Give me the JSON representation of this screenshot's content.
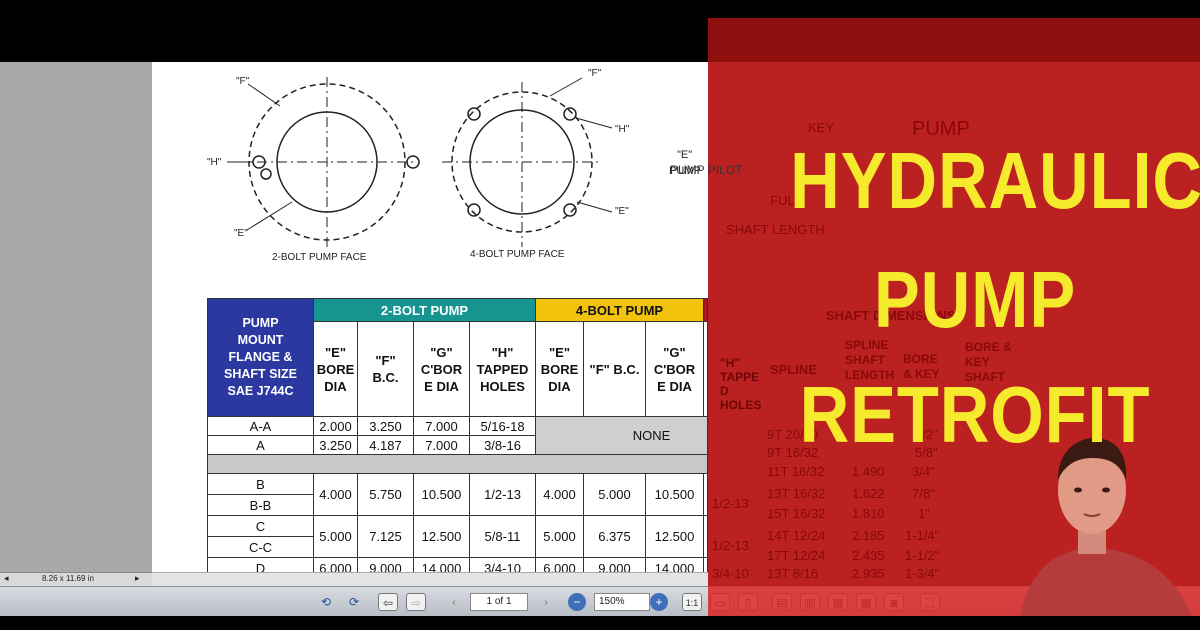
{
  "viewer": {
    "page_size": "8.26 x 11.69 in",
    "page_indicator": "1 of 1",
    "zoom": "150%"
  },
  "drawing": {
    "two_bolt_caption": "2-BOLT PUMP FACE",
    "four_bolt_caption": "4-BOLT PUMP FACE",
    "label_f": "\"F\"",
    "label_h": "\"H\"",
    "label_e": "\"E\"",
    "shaft_labels": {
      "key": "KEY",
      "pump": "PUMP",
      "pump_pilot_e": "\"E\"",
      "pump_pilot": "PUMP PILOT",
      "full": "FULL",
      "shaft_length": "SHAFT LENGTH"
    }
  },
  "table": {
    "mount_header": [
      "PUMP",
      "MOUNT",
      "FLANGE &",
      "SHAFT SIZE",
      "SAE J744C"
    ],
    "group_2bolt": "2-BOLT PUMP",
    "group_4bolt": "4-BOLT PUMP",
    "group_shaft": "SHAFT DIMENSIONS",
    "sub_2bolt": [
      [
        "\"E\"",
        "BORE",
        "DIA"
      ],
      [
        "\"F\"",
        "B.C."
      ],
      [
        "\"G\"",
        "C'BOR",
        "E DIA"
      ],
      [
        "\"H\"",
        "TAPPED",
        "HOLES"
      ]
    ],
    "sub_4bolt": [
      [
        "\"E\"",
        "BORE",
        "DIA"
      ],
      [
        "\"F\" B.C."
      ],
      [
        "\"G\"",
        "C'BOR",
        "E DIA"
      ],
      [
        "\"H\"",
        "TAPPE",
        "D",
        "HOLES"
      ]
    ],
    "sub_shaft": [
      [
        "SPLINE"
      ],
      [
        "SPLINE",
        "SHAFT",
        "LENGTH"
      ],
      [
        "BORE",
        "& KEY"
      ],
      [
        "BORE &",
        "KEY",
        "SHAFT"
      ]
    ],
    "none_label": "NONE",
    "rows_top": [
      {
        "mount": "A-A",
        "e": "2.000",
        "f": "3.250",
        "g": "7.000",
        "h": "5/16-18",
        "spline": "9T 20/40",
        "len": "",
        "bore": "1/2\""
      },
      {
        "mount": "A",
        "e": "3.250",
        "f": "4.187",
        "g": "7.000",
        "h": "3/8-16",
        "spline": "9T 16/32",
        "len": "",
        "bore": "5/8\""
      }
    ],
    "row_gray": {
      "spline": "11T 16/32",
      "len": "1.490",
      "bore": "3/4\""
    },
    "row_b": {
      "mount1": "B",
      "mount2": "B-B",
      "e": "4.000",
      "f": "5.750",
      "g": "10.500",
      "h": "1/2-13",
      "e4": "4.000",
      "f4": "5.000",
      "g4": "10.500",
      "h4": "1/2-13",
      "spline1": "13T 16/32",
      "len1": "1.622",
      "bore1": "7/8\"",
      "spline2": "15T 16/32",
      "len2": "1.810",
      "bore2": "1\""
    },
    "row_c": {
      "mount1": "C",
      "mount2": "C-C",
      "e": "5.000",
      "f": "7.125",
      "g": "12.500",
      "h": "5/8-11",
      "e4": "5.000",
      "f4": "6.375",
      "g4": "12.500",
      "h4": "1/2-13",
      "spline1": "14T 12/24",
      "len1": "2.185",
      "bore1": "1-1/4\"",
      "spline2": "17T 12/24",
      "len2": "2.435",
      "bore2": "1-1/2\""
    },
    "row_d": {
      "mount": "D",
      "e": "6.000",
      "f": "9.000",
      "g": "14.000",
      "h": "3/4-10",
      "e4": "6.000",
      "f4": "9.000",
      "g4": "14.000",
      "h4": "3/4-10",
      "spline": "13T 8/16",
      "len": "2.935",
      "bore": "1-3/4\""
    }
  },
  "overlay": {
    "title_line1": "HYDRAULIC",
    "title_line2": "PUMP",
    "title_line3": "RETROFIT",
    "title_color": "#f6ea2c",
    "overlay_color": "#da2626"
  }
}
